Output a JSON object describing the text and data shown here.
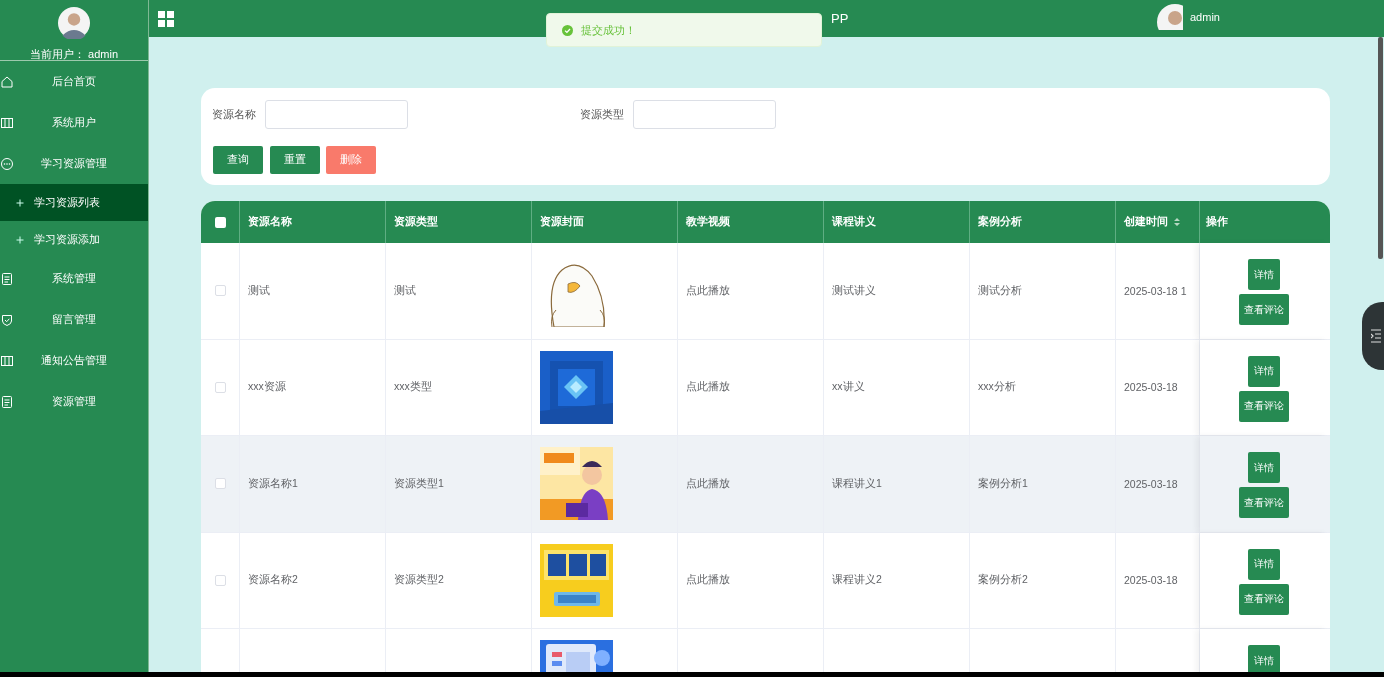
{
  "sidebar": {
    "user_label": "当前用户：",
    "user_name": "admin",
    "menu": [
      {
        "label": "后台首页",
        "selected": false
      },
      {
        "label": "系统用户",
        "selected": false
      },
      {
        "label": "学习资源管理",
        "selected": false,
        "expanded": true,
        "children": [
          {
            "label": "学习资源列表",
            "selected": true
          },
          {
            "label": "学习资源添加",
            "selected": false
          }
        ]
      },
      {
        "label": "系统管理",
        "selected": false
      },
      {
        "label": "留言管理",
        "selected": false
      },
      {
        "label": "通知公告管理",
        "selected": false
      },
      {
        "label": "资源管理",
        "selected": false
      }
    ]
  },
  "header": {
    "title": "PP",
    "user_name": "admin"
  },
  "toast": {
    "kind": "success",
    "message": "提交成功！"
  },
  "search": {
    "fields": [
      {
        "label": "资源名称"
      },
      {
        "label": "资源类型"
      }
    ],
    "buttons": [
      {
        "label": "查询",
        "kind": "primary"
      },
      {
        "label": "重置",
        "kind": "primary"
      },
      {
        "label": "删除",
        "kind": "danger"
      }
    ]
  },
  "table": {
    "select_all": {
      "checked": false
    },
    "columns": [
      {
        "label": "资源名称",
        "sortable": false
      },
      {
        "label": "资源类型",
        "sortable": false
      },
      {
        "label": "资源封面",
        "sortable": false
      },
      {
        "label": "教学视频",
        "sortable": false
      },
      {
        "label": "课程讲义",
        "sortable": false
      },
      {
        "label": "案例分析",
        "sortable": false
      },
      {
        "label": "创建时间",
        "sortable": true
      },
      {
        "label": "操作",
        "sortable": false
      }
    ],
    "rows": [
      {
        "checked": false,
        "highlighted": false,
        "name": "测试",
        "type": "测试",
        "cover": {
          "kind": "picture"
        },
        "video": "点此播放",
        "lecture": "测试讲义",
        "case": "测试分析",
        "time": "2025-03-18 1",
        "actions": [
          "详情",
          "查看评论"
        ]
      },
      {
        "checked": false,
        "highlighted": false,
        "name": "xxx资源",
        "type": "xxx类型",
        "cover": {
          "kind": "picture"
        },
        "video": "点此播放",
        "lecture": "xx讲义",
        "case": "xxx分析",
        "time": "2025-03-18",
        "actions": [
          "详情",
          "查看评论"
        ]
      },
      {
        "checked": false,
        "highlighted": true,
        "name": "资源名称1",
        "type": "资源类型1",
        "cover": {
          "kind": "picture"
        },
        "video": "点此播放",
        "lecture": "课程讲义1",
        "case": "案例分析1",
        "time": "2025-03-18",
        "actions": [
          "详情",
          "查看评论"
        ]
      },
      {
        "checked": false,
        "highlighted": false,
        "name": "资源名称2",
        "type": "资源类型2",
        "cover": {
          "kind": "picture"
        },
        "video": "点此播放",
        "lecture": "课程讲义2",
        "case": "案例分析2",
        "time": "2025-03-18",
        "actions": [
          "详情",
          "查看评论"
        ]
      },
      {
        "highlighted": false,
        "cover": {
          "kind": "picture"
        },
        "actions": [
          "详情"
        ]
      }
    ]
  }
}
